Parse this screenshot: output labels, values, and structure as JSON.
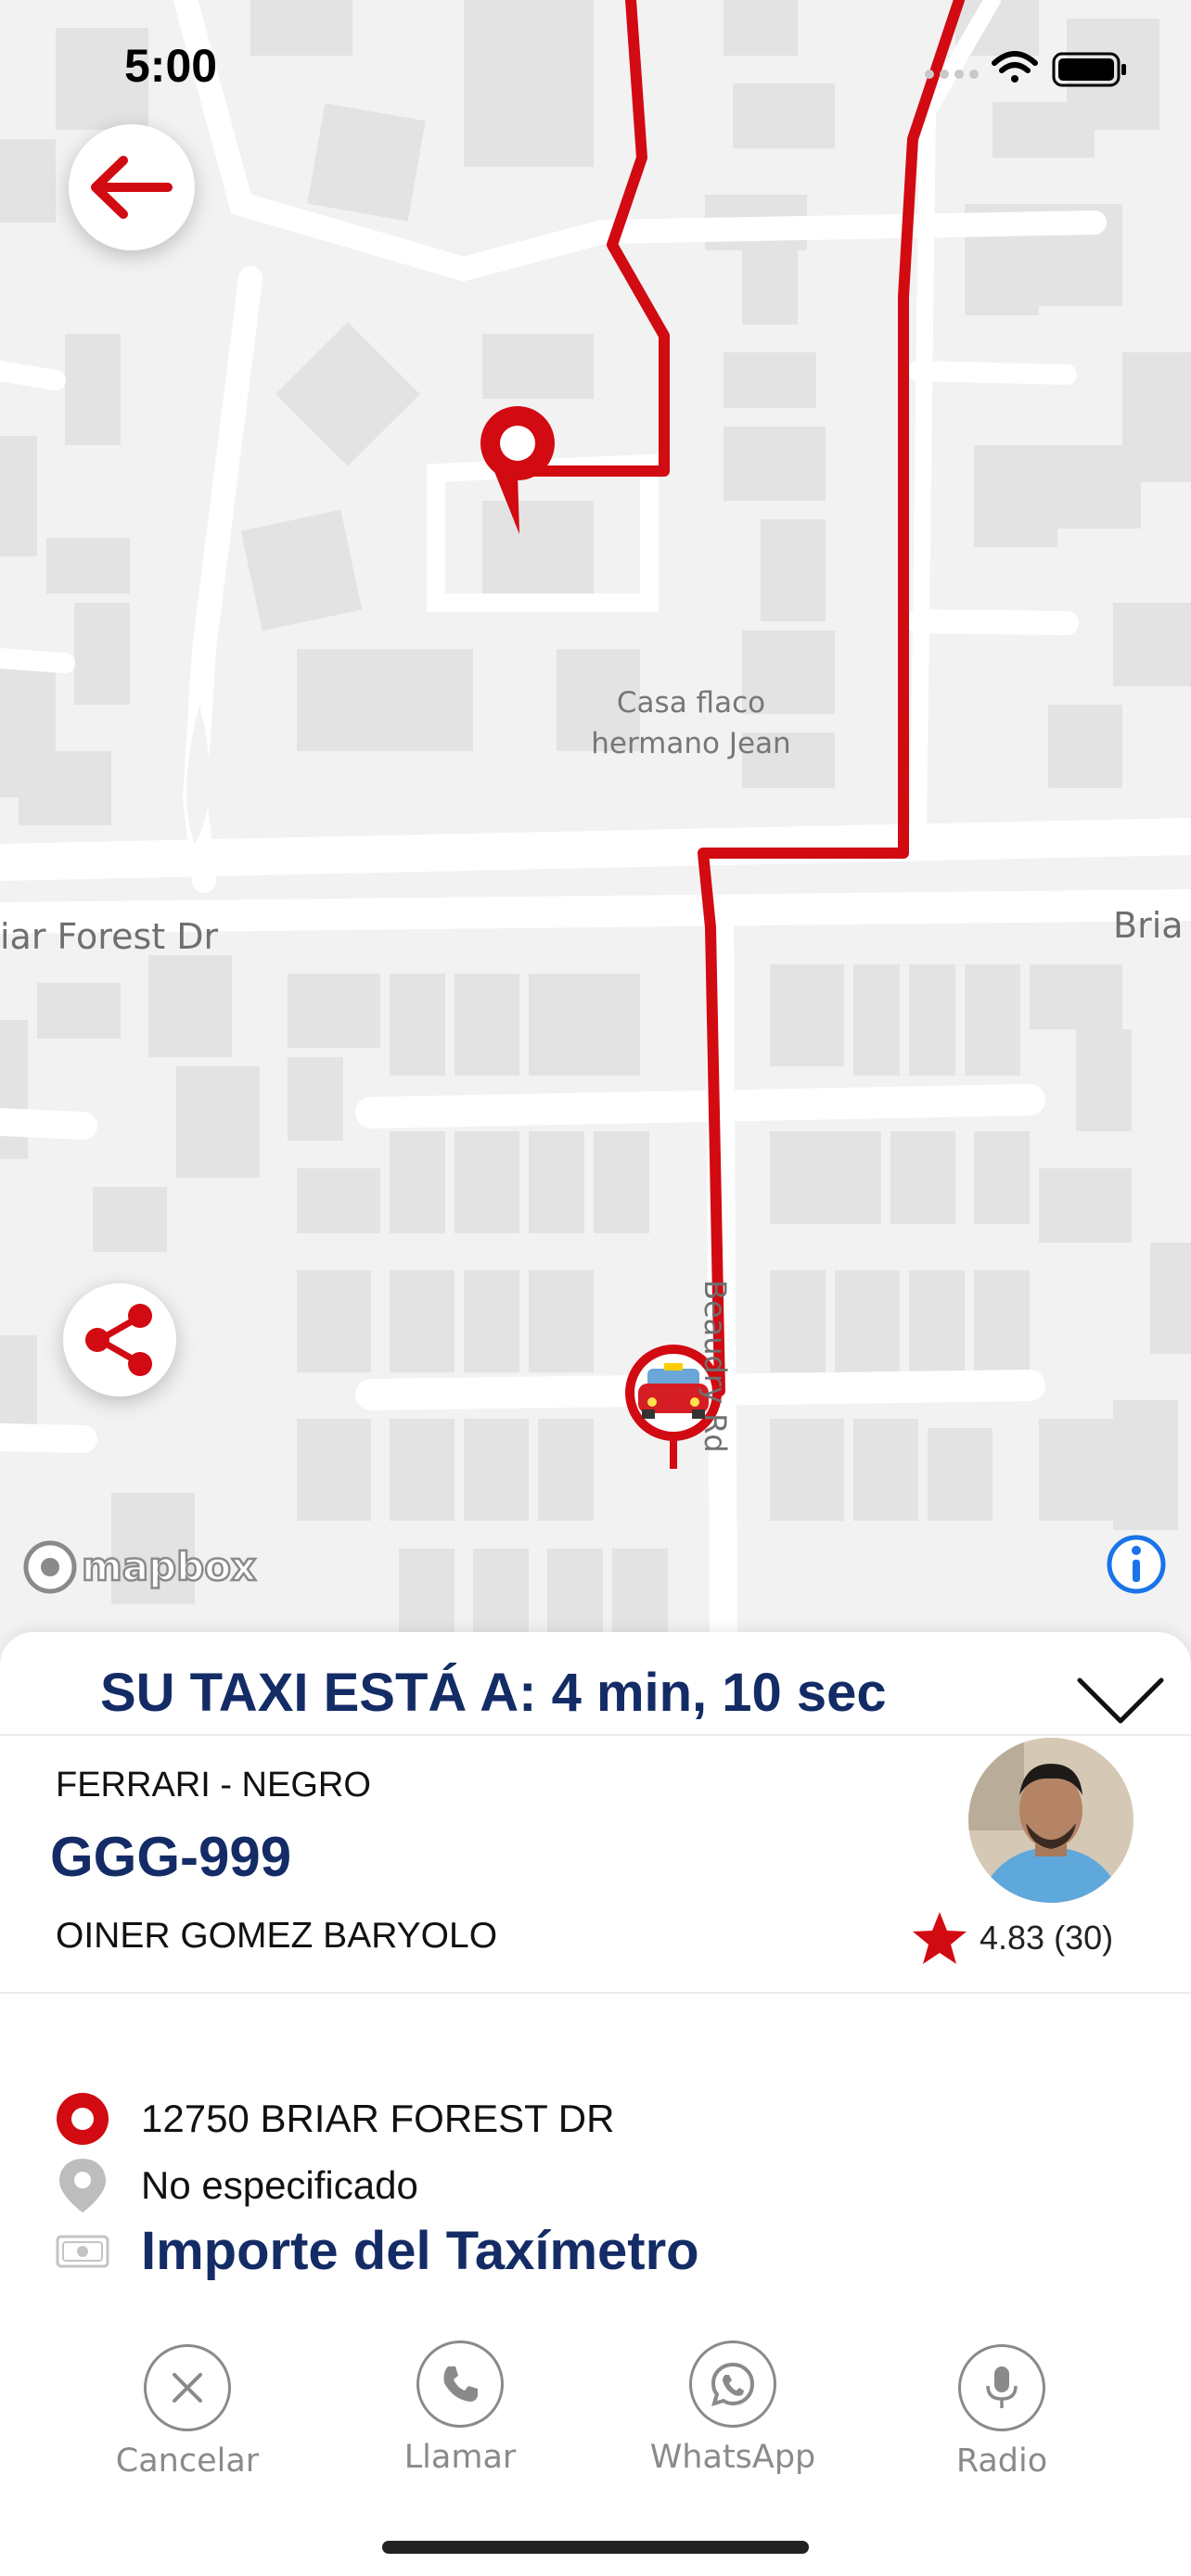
{
  "status_bar": {
    "time": "5:00"
  },
  "map": {
    "poi_label": "Casa flaco\nhermano Jean",
    "street_left": "iar Forest Dr",
    "street_right": "Bria",
    "street_vertical": "Beaudry Rd",
    "attribution": "mapbox",
    "route_color": "#d20a11"
  },
  "sheet": {
    "eta_text": "SU TAXI ESTÁ A: 4 min, 10 sec",
    "car_model": "FERRARI - NEGRO",
    "plate": "GGG-999",
    "driver_name": "OINER GOMEZ BARYOLO",
    "rating": "4.83 (30)",
    "pickup_address": "12750 BRIAR FOREST DR",
    "destination": "No especificado",
    "fare_label": "Importe del Taxímetro",
    "title_color": "#142c66"
  },
  "actions": [
    {
      "label": "Cancelar",
      "icon": "close-icon"
    },
    {
      "label": "Llamar",
      "icon": "phone-icon"
    },
    {
      "label": "WhatsApp",
      "icon": "whatsapp-icon"
    },
    {
      "label": "Radio",
      "icon": "microphone-icon"
    }
  ]
}
